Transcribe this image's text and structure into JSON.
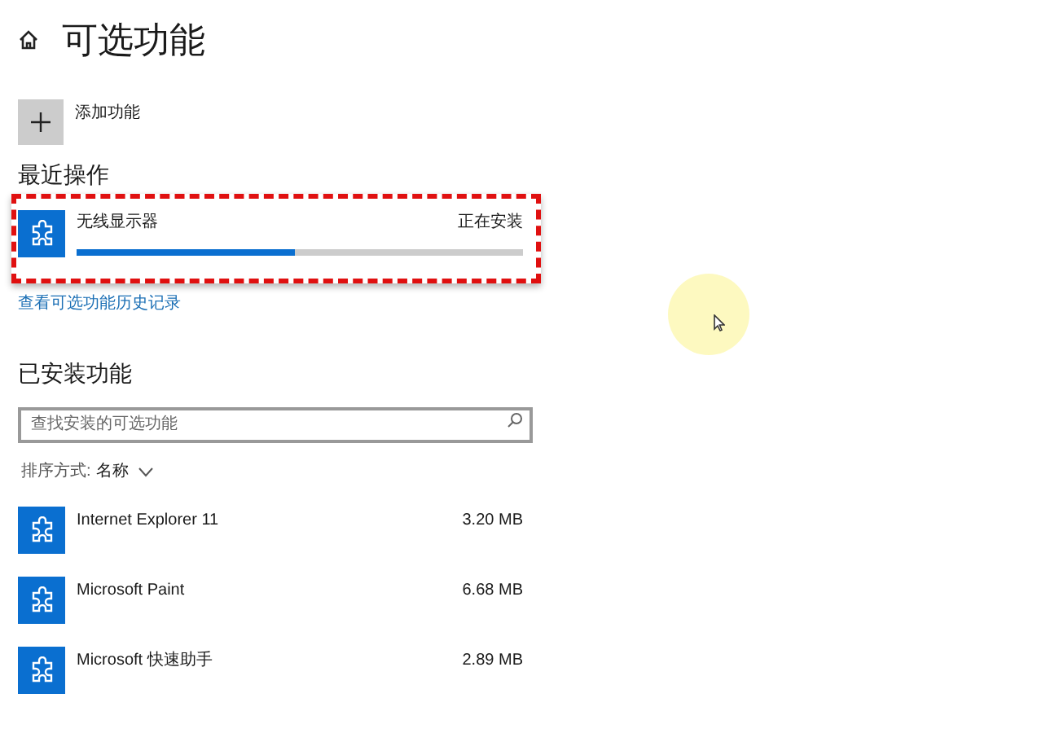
{
  "header": {
    "title": "可选功能"
  },
  "add_feature": {
    "label": "添加功能"
  },
  "recent": {
    "heading": "最近操作",
    "items": [
      {
        "name": "无线显示器",
        "status": "正在安装",
        "level": 0.49
      }
    ]
  },
  "history_link": "查看可选功能历史记录",
  "installed": {
    "heading": "已安装功能",
    "search": {
      "placeholder": "查找安装的可选功能"
    },
    "sort": {
      "label": "排序方式:",
      "value": "名称"
    },
    "items": [
      {
        "name": "Internet Explorer 11",
        "size": "3.20 MB"
      },
      {
        "name": "Microsoft Paint",
        "size": "6.68 MB"
      },
      {
        "name": "Microsoft 快速助手",
        "size": "2.89 MB"
      }
    ]
  }
}
